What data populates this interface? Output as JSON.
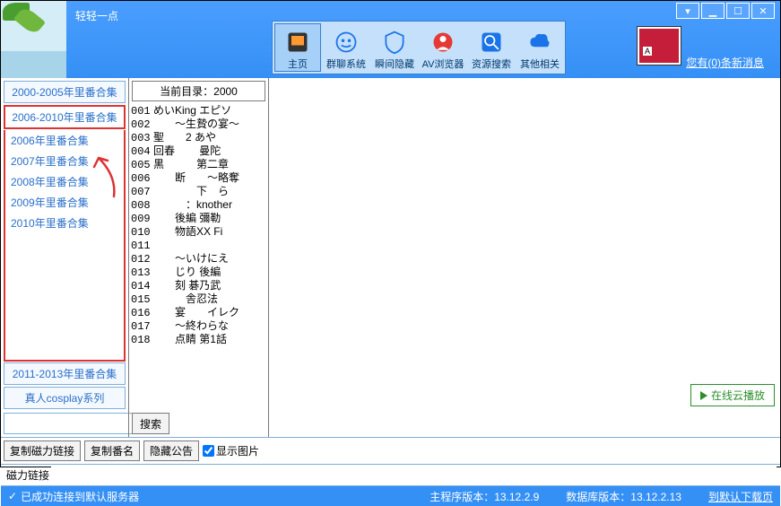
{
  "app": {
    "title": "轻轻一点"
  },
  "win": {
    "min": "▁",
    "max": "☐",
    "close": "✕"
  },
  "toolbar": {
    "items": [
      {
        "label": "主页",
        "active": true
      },
      {
        "label": "群聊系统"
      },
      {
        "label": "瞬间隐藏"
      },
      {
        "label": "AV浏览器"
      },
      {
        "label": "资源搜索"
      },
      {
        "label": "其他相关"
      }
    ]
  },
  "msg_link": "您有(0)条新消息",
  "categories": {
    "top": "2000-2005年里番合集",
    "active": "2006-2010年里番合集",
    "subs": [
      "2006年里番合集",
      "2007年里番合集",
      "2008年里番合集",
      "2009年里番合集",
      "2010年里番合集"
    ],
    "tail": [
      "2011-2013年里番合集",
      "真人cosplay系列"
    ]
  },
  "dir_label": "当前目录：2000",
  "files": [
    {
      "n": "001",
      "t": "めいKing エピソ"
    },
    {
      "n": "002",
      "t": "　　～生贄の宴～"
    },
    {
      "n": "003",
      "t": "聖　　2 あや　"
    },
    {
      "n": "004",
      "t": "回春　　 曼陀　"
    },
    {
      "n": "005",
      "t": "黒　　　第二章"
    },
    {
      "n": "006",
      "t": "　　断　　～略奪"
    },
    {
      "n": "007",
      "t": "　　　　下　ら"
    },
    {
      "n": "008",
      "t": "　　　：knother"
    },
    {
      "n": "009",
      "t": "　　後編 彌勒　"
    },
    {
      "n": "010",
      "t": "　　物語XX Fi"
    },
    {
      "n": "011",
      "t": ""
    },
    {
      "n": "012",
      "t": "　　～いけにえ"
    },
    {
      "n": "013",
      "t": "　　じり 後編"
    },
    {
      "n": "014",
      "t": "　　刻 碁乃武"
    },
    {
      "n": "015",
      "t": "　　　舎忍法　"
    },
    {
      "n": "016",
      "t": "　　宴　　イレク"
    },
    {
      "n": "017",
      "t": "　　～終わらな"
    },
    {
      "n": "018",
      "t": "　　点睛 第1話"
    }
  ],
  "search": {
    "placeholder": "",
    "btn": "搜索"
  },
  "bottom": {
    "copy_magnet": "复制磁力链接",
    "copy_name": "复制番名",
    "hide_notice": "隐藏公告",
    "show_img": "显示图片"
  },
  "magnet_label": "磁力链接",
  "play_btn": "在线云播放",
  "status": {
    "conn": "已成功连接到默认服务器",
    "main_ver_lbl": "主程序版本：",
    "main_ver": "13.12.2.9",
    "db_ver_lbl": "数据库版本：",
    "db_ver": "13.12.2.13",
    "dl": "到默认下载页"
  }
}
